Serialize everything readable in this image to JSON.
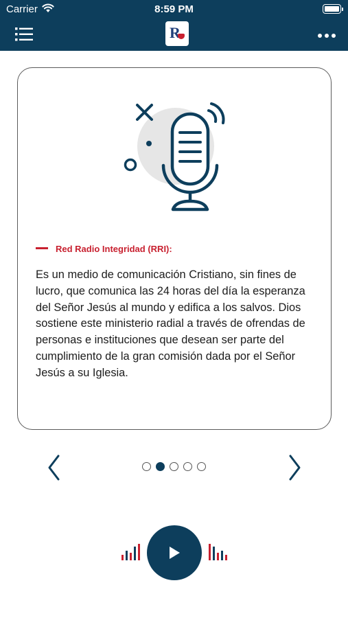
{
  "status_bar": {
    "carrier": "Carrier",
    "time": "8:59 PM"
  },
  "header": {
    "logo_letter": "R",
    "menu_icon": "list-icon",
    "more_icon": "ellipsis-icon",
    "background_color": "#0d3e5c"
  },
  "card": {
    "illustration_icon": "microphone-icon",
    "section_title": "Red Radio Integridad (RRI):",
    "description": "Es un medio de comunicación Cristiano, sin fines de lucro, que comunica las 24 horas del día la esperanza del Señor Jesús al mundo y edifica a los salvos. Dios sostiene este ministerio radial a través de ofrendas de personas e instituciones que desean ser parte del cumplimiento de la gran comisión dada por el Señor Jesús a su Iglesia.",
    "accent_color": "#c8202f"
  },
  "carousel": {
    "prev_icon": "chevron-left-icon",
    "next_icon": "chevron-right-icon",
    "page_count": 5,
    "current_page": 2
  },
  "player": {
    "play_icon": "play-icon",
    "equalizer_icon": "equalizer-icon"
  }
}
